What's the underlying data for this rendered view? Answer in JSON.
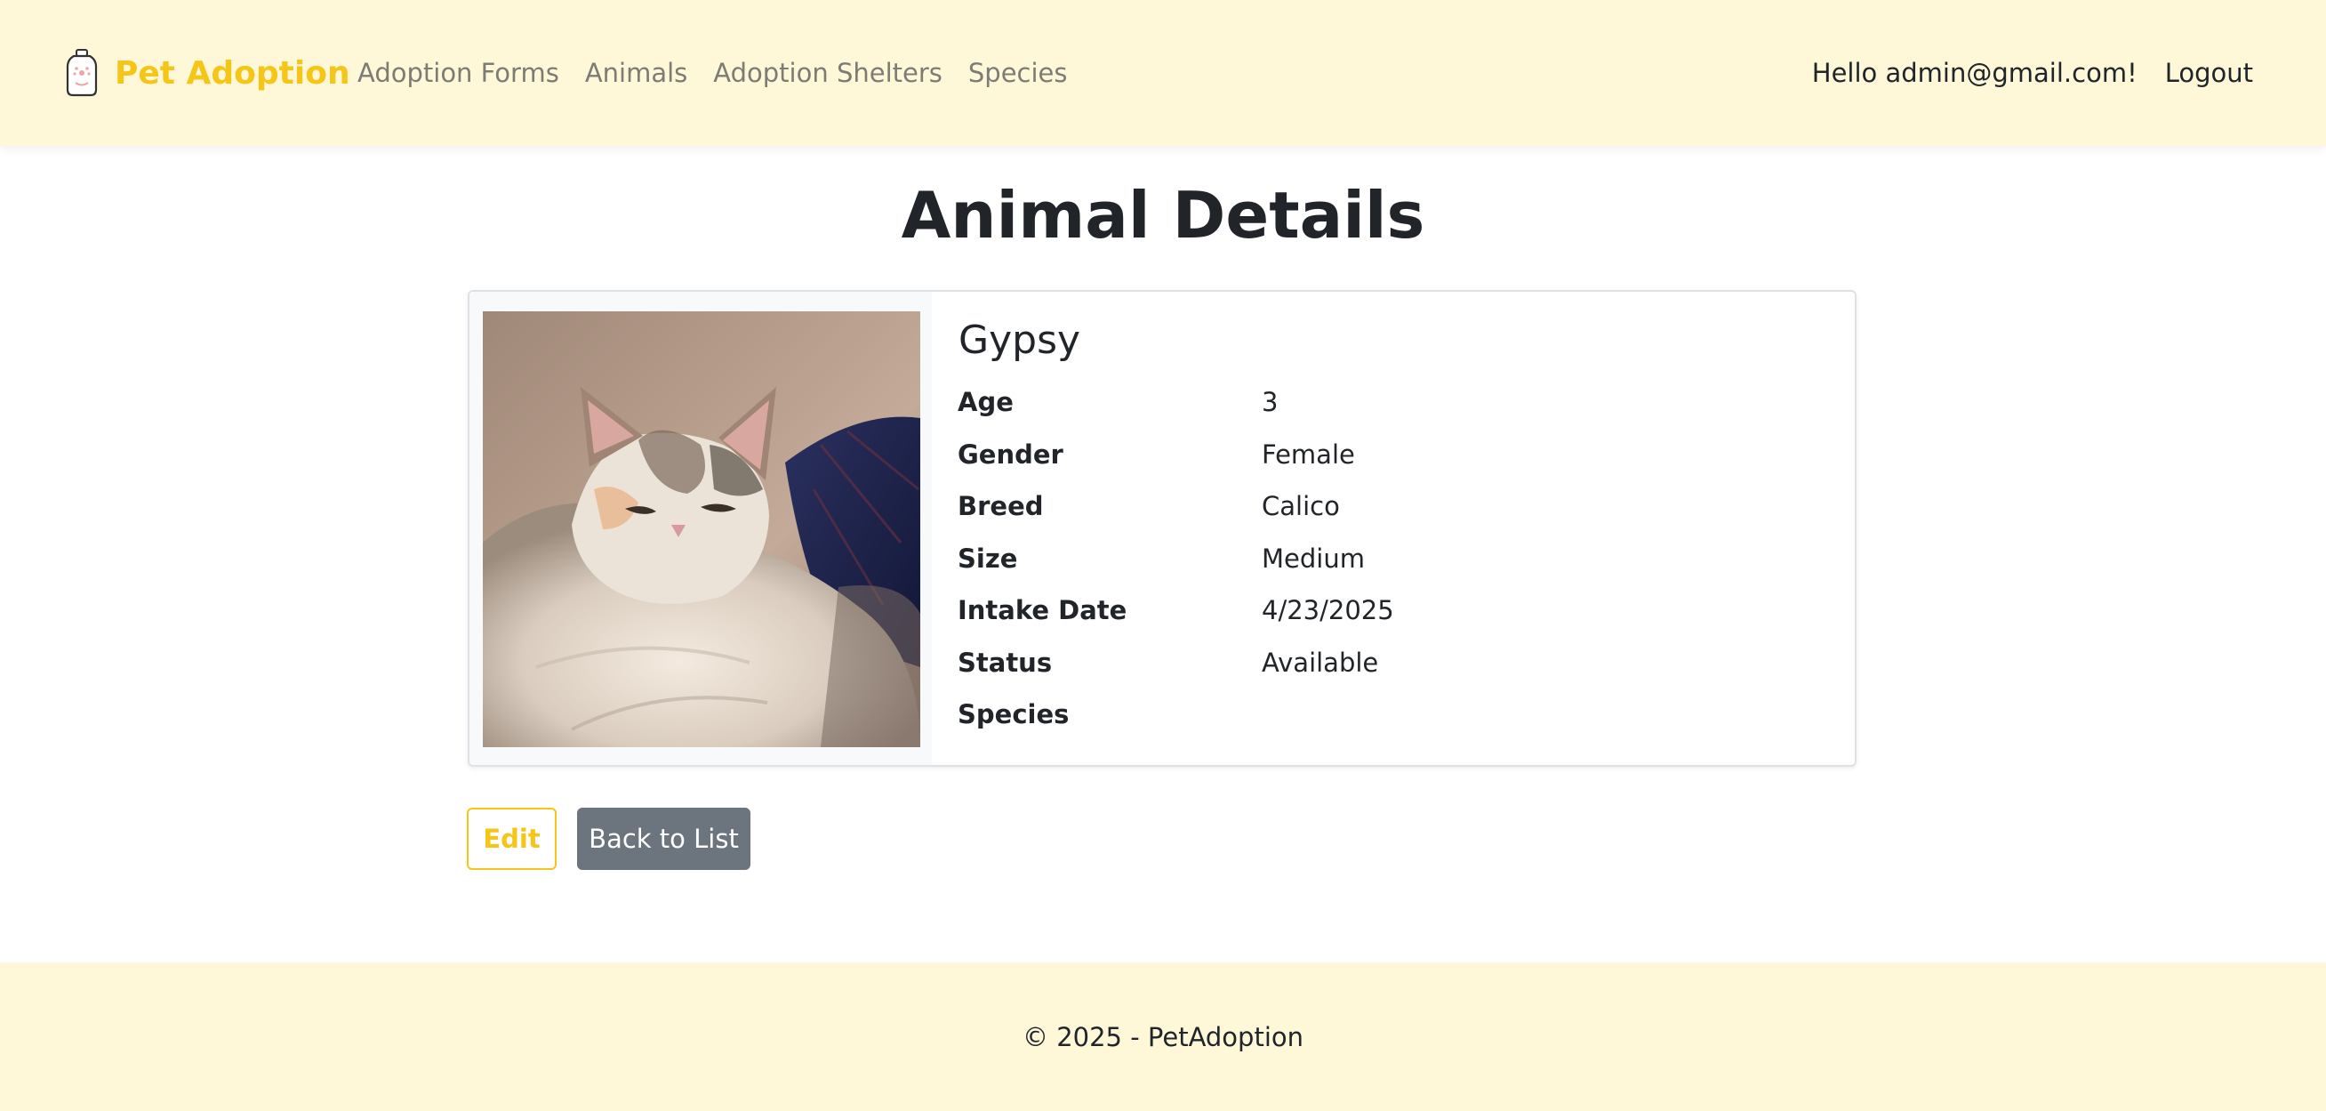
{
  "brand": {
    "name": "Pet Adoption",
    "logo_icon": "pet-bottle-logo-icon",
    "color": "#f5c518"
  },
  "nav": {
    "links": [
      "Adoption Forms",
      "Animals",
      "Adoption Shelters",
      "Species"
    ],
    "greeting": "Hello admin@gmail.com!",
    "logout": "Logout"
  },
  "page": {
    "title": "Animal Details"
  },
  "animal": {
    "name": "Gypsy",
    "photo_icon": "calico-cat-photo",
    "details": [
      {
        "label": "Age",
        "value": "3"
      },
      {
        "label": "Gender",
        "value": "Female"
      },
      {
        "label": "Breed",
        "value": "Calico"
      },
      {
        "label": "Size",
        "value": "Medium"
      },
      {
        "label": "Intake Date",
        "value": "4/23/2025"
      },
      {
        "label": "Status",
        "value": "Available"
      },
      {
        "label": "Species",
        "value": ""
      }
    ]
  },
  "actions": {
    "edit": "Edit",
    "back": "Back to List"
  },
  "footer": {
    "text": "© 2025 - PetAdoption"
  },
  "colors": {
    "nav_bg": "#fef8d9",
    "accent": "#f5c518",
    "secondary_button": "#6c757d"
  }
}
